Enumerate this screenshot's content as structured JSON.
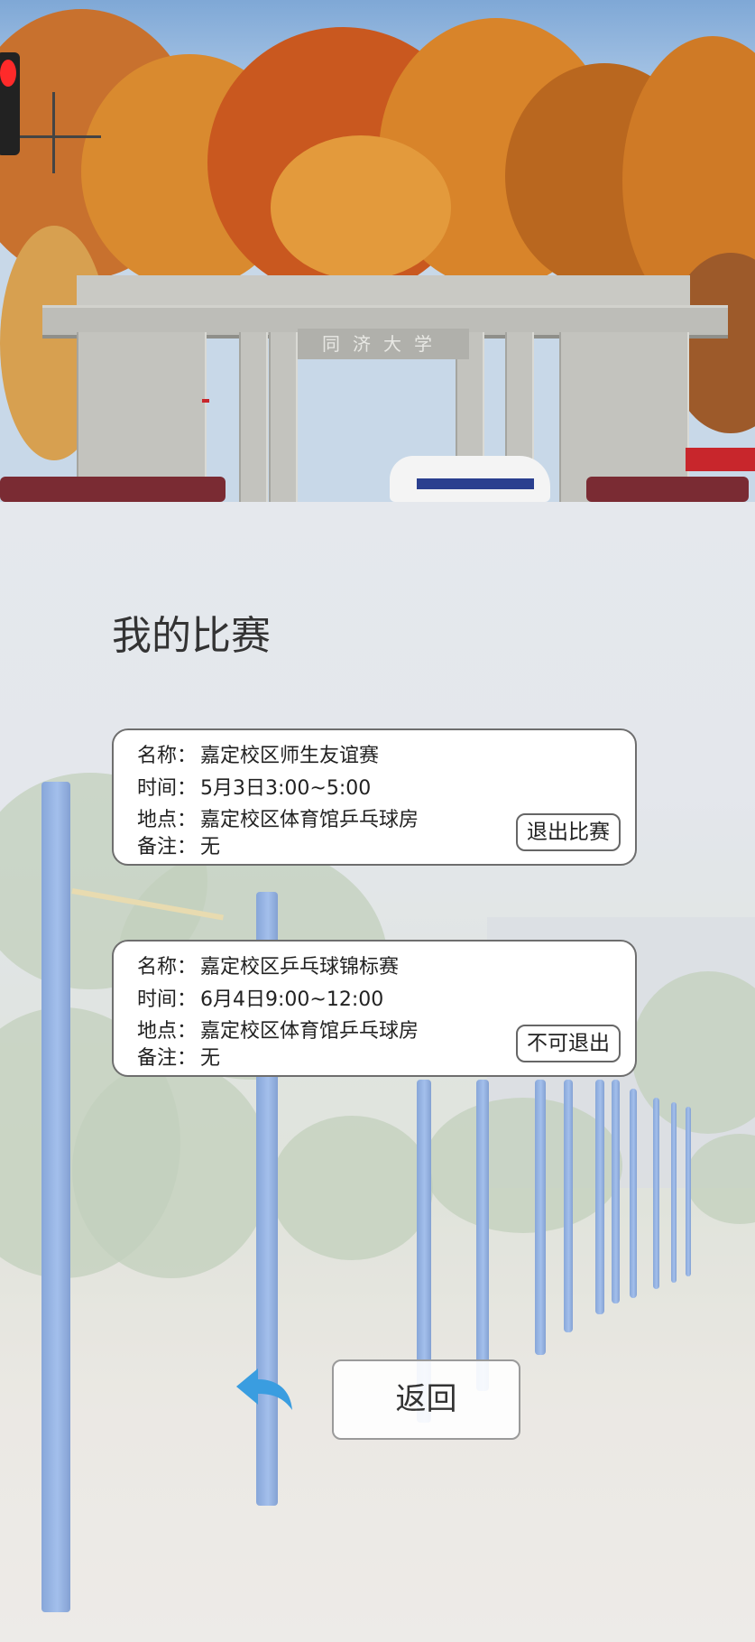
{
  "gate_sign": "同济大学",
  "page_title": "我的比赛",
  "labels": {
    "name": "名称：",
    "time": "时间：",
    "place": "地点：",
    "note": "备注："
  },
  "matches": [
    {
      "name": "嘉定校区师生友谊赛",
      "time": "5月3日3:00~5:00",
      "place": "嘉定校区体育馆乒乓球房",
      "note": "无",
      "action": "退出比赛"
    },
    {
      "name": "嘉定校区乒乓球锦标赛",
      "time": "6月4日9:00~12:00",
      "place": "嘉定校区体育馆乒乓球房",
      "note": "无",
      "action": "不可退出"
    }
  ],
  "back_label": "返回",
  "colors": {
    "accent_blue": "#3a9de0",
    "card_border": "#6e6e6e",
    "pole_blue": "#5b8dd6"
  }
}
